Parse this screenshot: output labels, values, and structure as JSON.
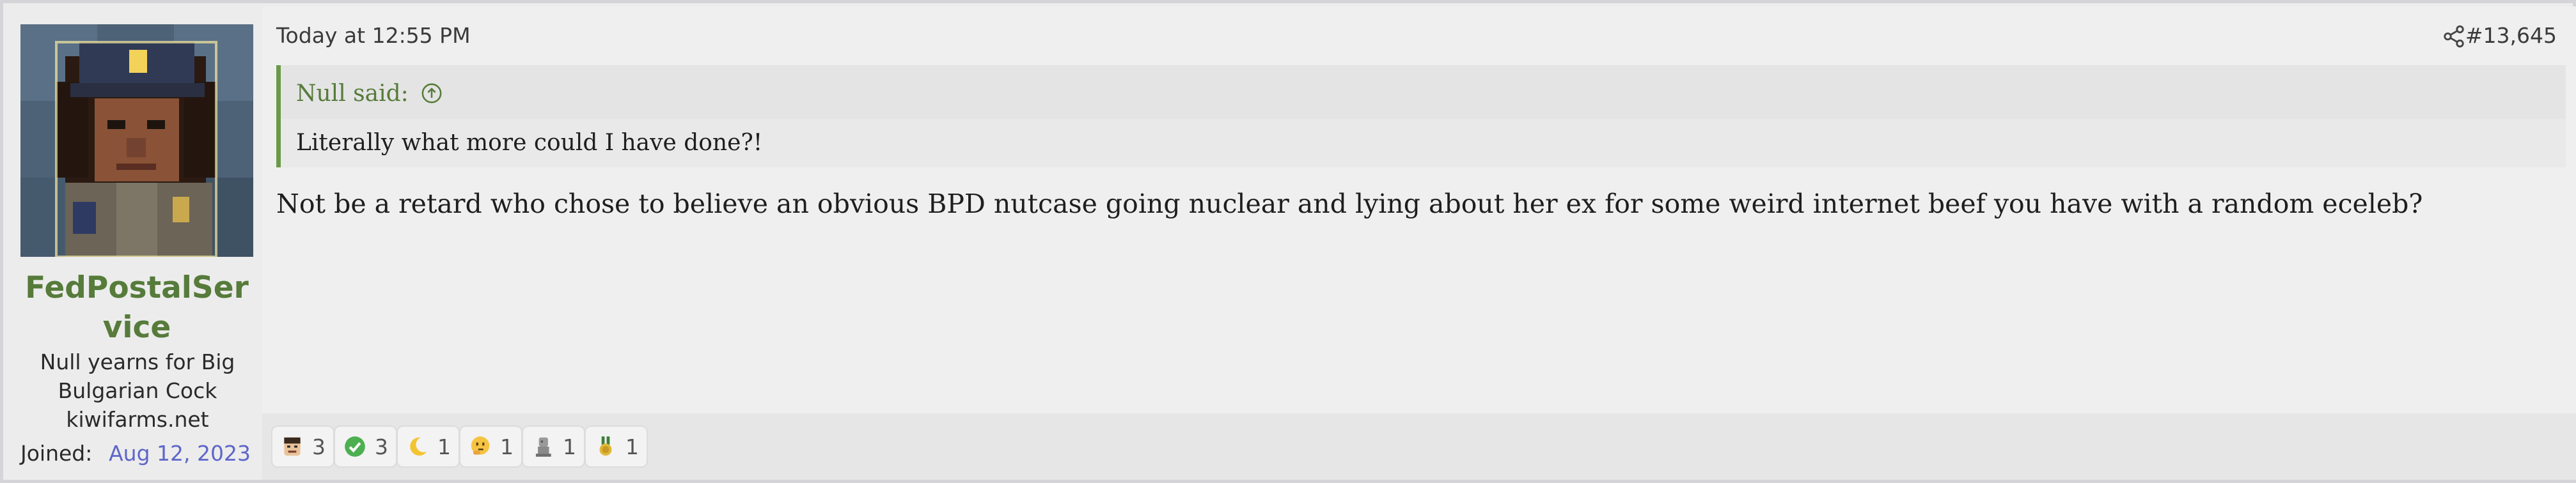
{
  "user": {
    "name": "FedPostalService",
    "title": "Null yearns for Big Bulgarian Cock kiwifarms.net",
    "joined_label": "Joined:",
    "joined_date": "Aug 12, 2023"
  },
  "post": {
    "date": "Today at 12:55 PM",
    "number": "#13,645",
    "quote": {
      "author_line": "Null said:",
      "text": "Literally what more could I have done?!"
    },
    "message": "Not be a retard who chose to believe an obvious BPD nutcase going nuclear and lying about her ex for some weird internet beef you have with a random eceleb?"
  },
  "reactions": [
    {
      "icon": "face-emoji-icon",
      "count": "3"
    },
    {
      "icon": "check-icon",
      "count": "3"
    },
    {
      "icon": "crescent-moon-icon",
      "count": "1"
    },
    {
      "icon": "thinking-face-icon",
      "count": "1"
    },
    {
      "icon": "statue-icon",
      "count": "1"
    },
    {
      "icon": "medal-icon",
      "count": "1"
    }
  ],
  "colors": {
    "username": "#567b3a",
    "quote_border": "#6a9a48",
    "joined_date": "#5d66c9"
  }
}
